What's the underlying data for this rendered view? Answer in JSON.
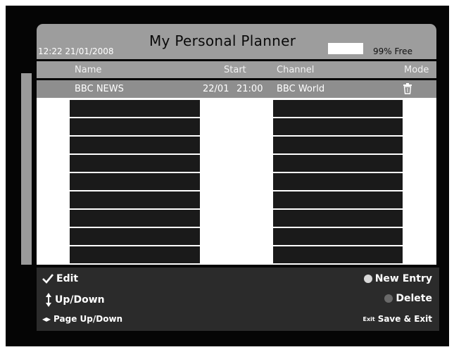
{
  "header": {
    "title": "My Personal Planner",
    "clock": "12:22 21/01/2008",
    "free_label": "99% Free"
  },
  "columns": {
    "name": "Name",
    "start": "Start",
    "channel": "Channel",
    "mode": "Mode"
  },
  "entries": [
    {
      "name": "BBC NEWS",
      "start_date": "22/01",
      "start_time": "21:00",
      "channel": "BBC World",
      "mode_icon": "trash-icon"
    }
  ],
  "footer": {
    "edit": "Edit",
    "up_down": "Up/Down",
    "page_up_down": "Page Up/Down",
    "new_entry": "New Entry",
    "delete": "Delete",
    "exit_tag": "Exit",
    "save_exit": "Save & Exit"
  },
  "colors": {
    "panel": "#9d9d9d",
    "slot": "#1a1a1a",
    "new_entry_dot": "#d9d9d9",
    "delete_dot": "#6a6a6a"
  }
}
